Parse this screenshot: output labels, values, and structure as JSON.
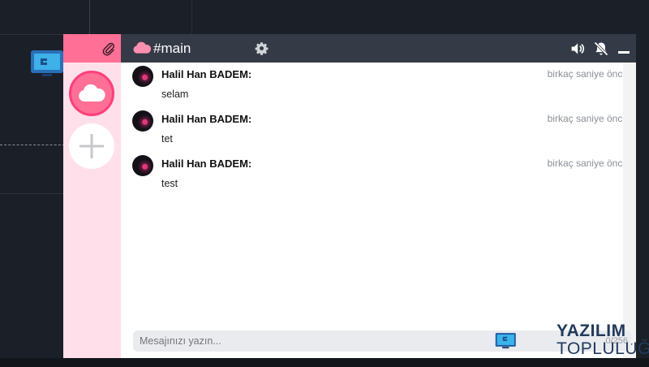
{
  "header": {
    "channel": "#main"
  },
  "messages": [
    {
      "author": "Halil Han BADEM:",
      "time": "birkaç saniye önce",
      "text": "selam"
    },
    {
      "author": "Halil Han BADEM:",
      "time": "birkaç saniye önce",
      "text": "tet"
    },
    {
      "author": "Halil Han BADEM:",
      "time": "birkaç saniye önce",
      "text": "test"
    }
  ],
  "composer": {
    "placeholder": "Mesajınızı yazın...",
    "counter": "0/256"
  },
  "watermark": {
    "line1": "YAZILIM",
    "line2": "TOPLULUĞU"
  },
  "colors": {
    "accent": "#ff6f96",
    "header": "#343a46",
    "sidebar": "#ffe0ea"
  },
  "icons": [
    "paperclip-icon",
    "cloud-icon",
    "plus-icon",
    "gear-icon",
    "volume-icon",
    "bell-muted-icon",
    "minimize-icon"
  ]
}
